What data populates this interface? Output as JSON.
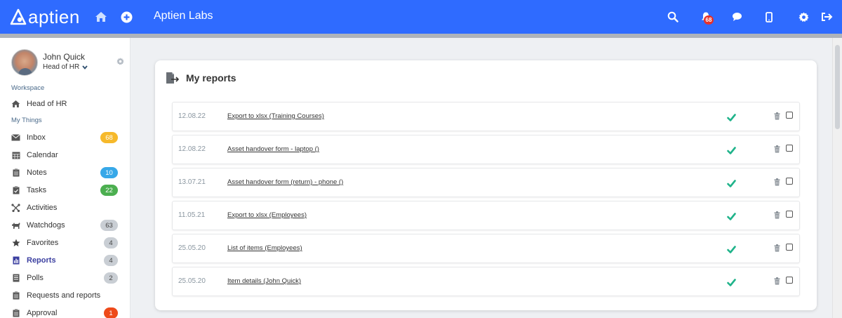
{
  "header": {
    "logo_text": "aptien",
    "app_title": "Aptien Labs",
    "notification_count": "68",
    "brand_color": "#2f6bff"
  },
  "user": {
    "name": "John Quick",
    "role": "Head of HR"
  },
  "sidebar": {
    "workspace_label": "Workspace",
    "workspace_item": "Head of HR",
    "mythings_label": "My Things",
    "items": [
      {
        "label": "Inbox",
        "count": "68",
        "icon": "envelope-icon",
        "badge_color": "#f6b92b"
      },
      {
        "label": "Calendar",
        "count": "",
        "icon": "calendar-icon",
        "badge_color": ""
      },
      {
        "label": "Notes",
        "count": "10",
        "icon": "clipboard-icon",
        "badge_color": "#37a8e8"
      },
      {
        "label": "Tasks",
        "count": "22",
        "icon": "tasks-icon",
        "badge_color": "#4caf50"
      },
      {
        "label": "Activities",
        "count": "",
        "icon": "activities-icon",
        "badge_color": ""
      },
      {
        "label": "Watchdogs",
        "count": "63",
        "icon": "dog-icon",
        "badge_color": "#c9ced4"
      },
      {
        "label": "Favorites",
        "count": "4",
        "icon": "star-icon",
        "badge_color": "#c9ced4"
      },
      {
        "label": "Reports",
        "count": "4",
        "icon": "report-icon",
        "badge_color": "#c9ced4"
      },
      {
        "label": "Polls",
        "count": "2",
        "icon": "poll-icon",
        "badge_color": "#c9ced4"
      },
      {
        "label": "Requests and reports",
        "count": "",
        "icon": "clipboard-icon",
        "badge_color": ""
      },
      {
        "label": "Approval",
        "count": "1",
        "icon": "clipboard-icon",
        "badge_color": "#ee4a1a"
      }
    ]
  },
  "main": {
    "title": "My reports",
    "reports": [
      {
        "date": "12.08.22",
        "name": "Export to xlsx (Training Courses)"
      },
      {
        "date": "12.08.22",
        "name": "Asset handover form - laptop ()"
      },
      {
        "date": "13.07.21",
        "name": "Asset handover form (return) - phone ()"
      },
      {
        "date": "11.05.21",
        "name": "Export to xlsx (Employees)"
      },
      {
        "date": "25.05.20",
        "name": "List of items (Employees)"
      },
      {
        "date": "25.05.20",
        "name": "Item details (John Quick)"
      }
    ]
  }
}
